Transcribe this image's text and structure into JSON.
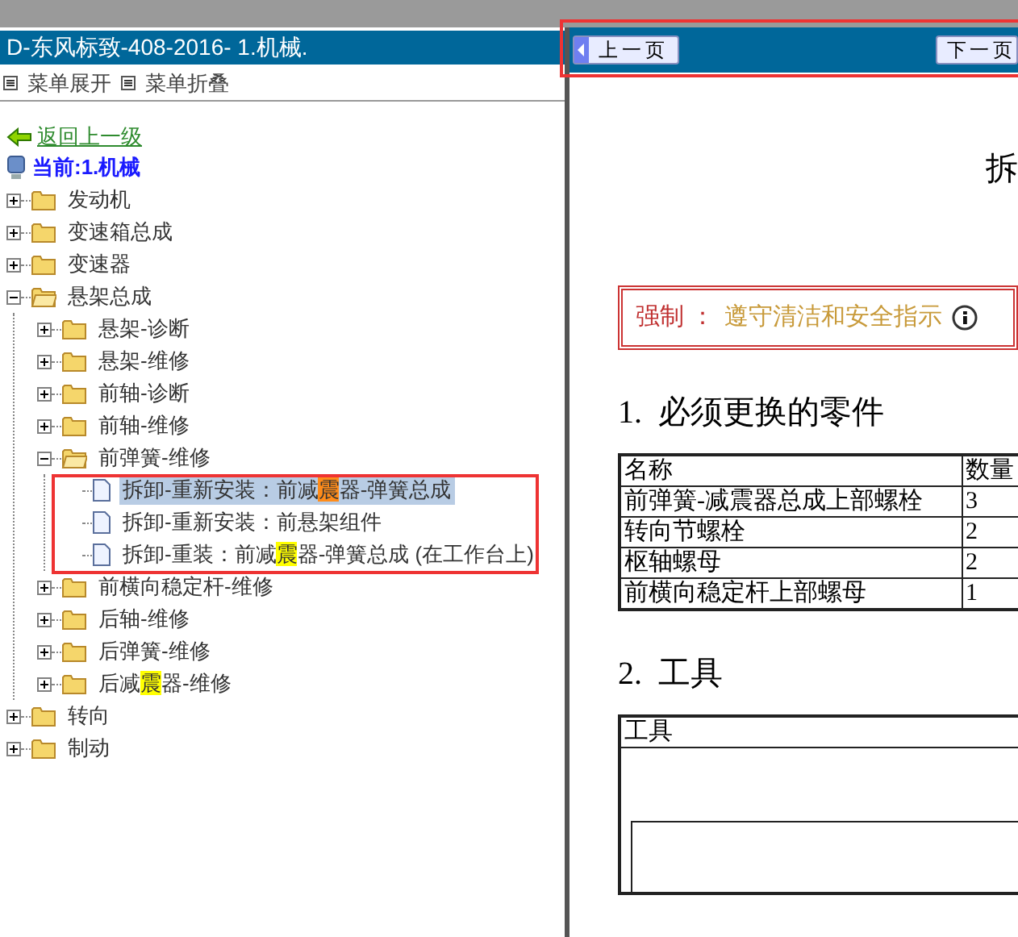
{
  "title": "D-东风标致-408-2016- 1.机械.",
  "menu_actions": [
    {
      "label": "菜单展开"
    },
    {
      "label": "菜单折叠"
    }
  ],
  "back_link": "返回上一级",
  "current": "当前:1.机械",
  "tree": [
    {
      "kind": "folder",
      "label": "发动机",
      "expanded": false,
      "selected": false
    },
    {
      "kind": "folder",
      "label": "变速箱总成",
      "expanded": false,
      "selected": false
    },
    {
      "kind": "folder",
      "label": "变速器",
      "expanded": false,
      "selected": false
    },
    {
      "kind": "folder",
      "label": "悬架总成",
      "expanded": true,
      "selected": false,
      "children": [
        {
          "kind": "folder",
          "label": "悬架-诊断",
          "expanded": false,
          "selected": false
        },
        {
          "kind": "folder",
          "label": "悬架-维修",
          "expanded": false,
          "selected": false
        },
        {
          "kind": "folder",
          "label": "前轴-诊断",
          "expanded": false,
          "selected": false
        },
        {
          "kind": "folder",
          "label": "前轴-维修",
          "expanded": false,
          "selected": false
        },
        {
          "kind": "folder",
          "label": "前弹簧-维修",
          "expanded": true,
          "selected": false,
          "children": [
            {
              "kind": "document",
              "selected": true,
              "segments": [
                {
                  "text": "拆卸-重新安装：前减"
                },
                {
                  "text": "震",
                  "color": "#ff8c1a"
                },
                {
                  "text": "器-弹簧总成"
                }
              ]
            },
            {
              "kind": "document",
              "selected": false,
              "label": "拆卸-重新安装：前悬架组件"
            },
            {
              "kind": "document",
              "selected": false,
              "segments": [
                {
                  "text": "拆卸-重装：前减"
                },
                {
                  "text": "震",
                  "color": "#ffff00"
                },
                {
                  "text": "器-弹簧总成 (在工作台上)"
                }
              ]
            }
          ]
        },
        {
          "kind": "folder",
          "label": "前横向稳定杆-维修",
          "expanded": false,
          "selected": false
        },
        {
          "kind": "folder",
          "label": "后轴-维修",
          "expanded": false,
          "selected": false
        },
        {
          "kind": "folder",
          "label": "后弹簧-维修",
          "expanded": false,
          "selected": false
        },
        {
          "kind": "folder",
          "expanded": false,
          "selected": false,
          "segments": [
            {
              "text": "后减"
            },
            {
              "text": "震",
              "color": "#ffff00"
            },
            {
              "text": "器-维修"
            }
          ]
        }
      ]
    },
    {
      "kind": "folder",
      "label": "转向",
      "expanded": false,
      "selected": false
    },
    {
      "kind": "folder",
      "label": "制动",
      "expanded": false,
      "selected": false
    }
  ],
  "pager": {
    "prev": "上一页",
    "next": "下一页"
  },
  "document": {
    "title_fragment": "拆",
    "notice": {
      "label": "强制 ：",
      "text": "遵守清洁和安全指示"
    },
    "sections": [
      {
        "heading": "1.  必须更换的零件",
        "table": {
          "columns": [
            "名称",
            "数量"
          ],
          "rows": [
            [
              "前弹簧-减震器总成上部螺栓",
              "3"
            ],
            [
              "转向节螺栓",
              "2"
            ],
            [
              "枢轴螺母",
              "2"
            ],
            [
              "前横向稳定杆上部螺母",
              "1"
            ]
          ]
        }
      },
      {
        "heading": "2.  工具",
        "table": {
          "columns": [
            "工具"
          ]
        }
      }
    ]
  }
}
